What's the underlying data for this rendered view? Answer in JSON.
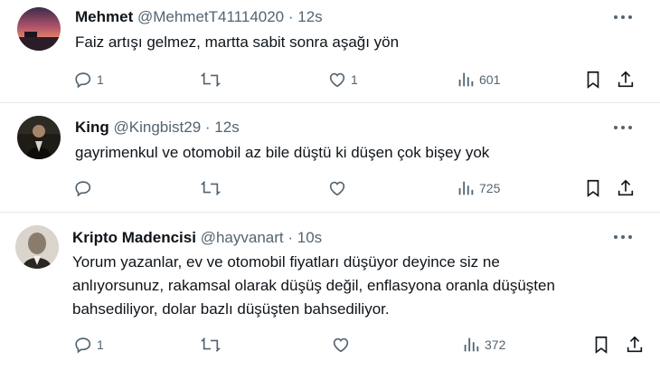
{
  "tweets": [
    {
      "name": "Mehmet",
      "handle": "@MehmetT41114020",
      "time": "· 12s",
      "text": "Faiz artışı gelmez, martta sabit sonra aşağı yön",
      "replies": "1",
      "retweets": "",
      "likes": "1",
      "views": "601"
    },
    {
      "name": "King",
      "handle": "@Kingbist29",
      "time": "· 12s",
      "text": "gayrimenkul ve otomobil az bile düştü ki düşen çok bişey yok",
      "replies": "",
      "retweets": "",
      "likes": "",
      "views": "725"
    },
    {
      "name": "Kripto Madencisi",
      "handle": "@hayvanart",
      "time": "· 10s",
      "text_lines": [
        "Yorum yazanlar, ev ve otomobil fiyatları düşüyor deyince siz ne",
        "anlıyorsunuz, rakamsal olarak düşüş değil, enflasyona oranla düşüşten",
        "bahsediliyor, dolar bazlı düşüşten bahsediliyor."
      ],
      "replies": "1",
      "retweets": "",
      "likes": "",
      "views": "372"
    }
  ],
  "icons": {
    "reply": "reply-icon",
    "retweet": "retweet-icon",
    "like": "heart-icon",
    "views": "views-icon",
    "bookmark": "bookmark-icon",
    "share": "share-icon",
    "more": "more-icon"
  },
  "colors": {
    "text": "#0f1419",
    "muted": "#536471",
    "divider": "#e6e9eb"
  }
}
